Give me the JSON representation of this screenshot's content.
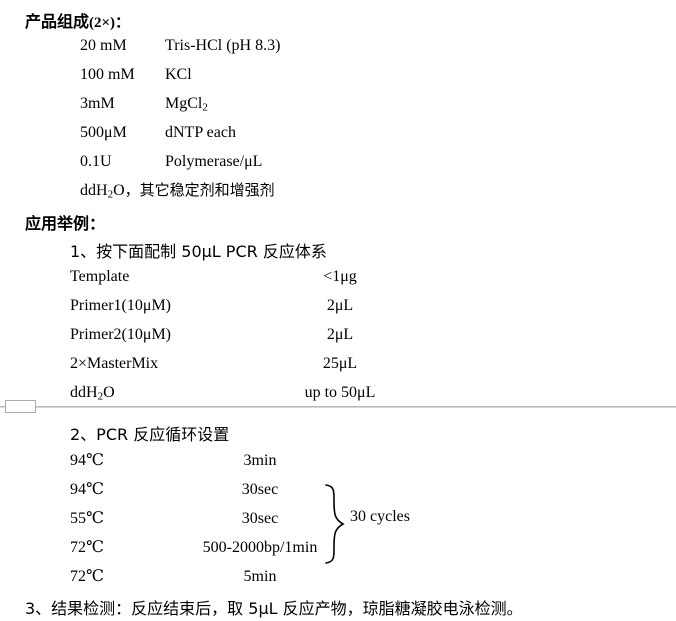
{
  "document": {
    "background_color": "#ffffff",
    "text_color": "#000000"
  },
  "composition": {
    "heading_main": "产品组成",
    "heading_suffix": "(2×)：",
    "rows": [
      {
        "amount": "20 mM",
        "reagent": "Tris-HCl (pH 8.3)"
      },
      {
        "amount": "100 mM",
        "reagent": "KCl"
      },
      {
        "amount": "3mM",
        "reagent": "MgCl2"
      },
      {
        "amount": "500μM",
        "reagent": "dNTP each"
      },
      {
        "amount": "0.1U",
        "reagent": "Polymerase/μL"
      }
    ],
    "footer_note": "ddH2O，其它稳定剂和增强剂"
  },
  "application": {
    "heading": "应用举例：",
    "step1_title": "1、按下面配制 50μL PCR 反应体系",
    "mix_rows": [
      {
        "component": "Template",
        "volume": "<1μg"
      },
      {
        "component": "Primer1(10μM)",
        "volume": "2μL"
      },
      {
        "component": "Primer2(10μM)",
        "volume": "2μL"
      },
      {
        "component": "2×MasterMix",
        "volume": "25μL"
      },
      {
        "component": "ddH2O",
        "volume": "up to 50μL"
      }
    ],
    "step2_title": "2、PCR 反应循环设置",
    "cycle_rows": [
      {
        "temperature": "94℃",
        "duration": "3min"
      },
      {
        "temperature": "94℃",
        "duration": "30sec"
      },
      {
        "temperature": "55℃",
        "duration": "30sec"
      },
      {
        "temperature": "72℃",
        "duration": "500-2000bp/1min"
      },
      {
        "temperature": "72℃",
        "duration": "5min"
      }
    ],
    "cycles_label": "30 cycles",
    "step3_text": "3、结果检测：反应结束后，取 5μL 反应产物，琼脂糖凝胶电泳检测。"
  },
  "section_break": {
    "marker_type": "section-break-marker"
  }
}
